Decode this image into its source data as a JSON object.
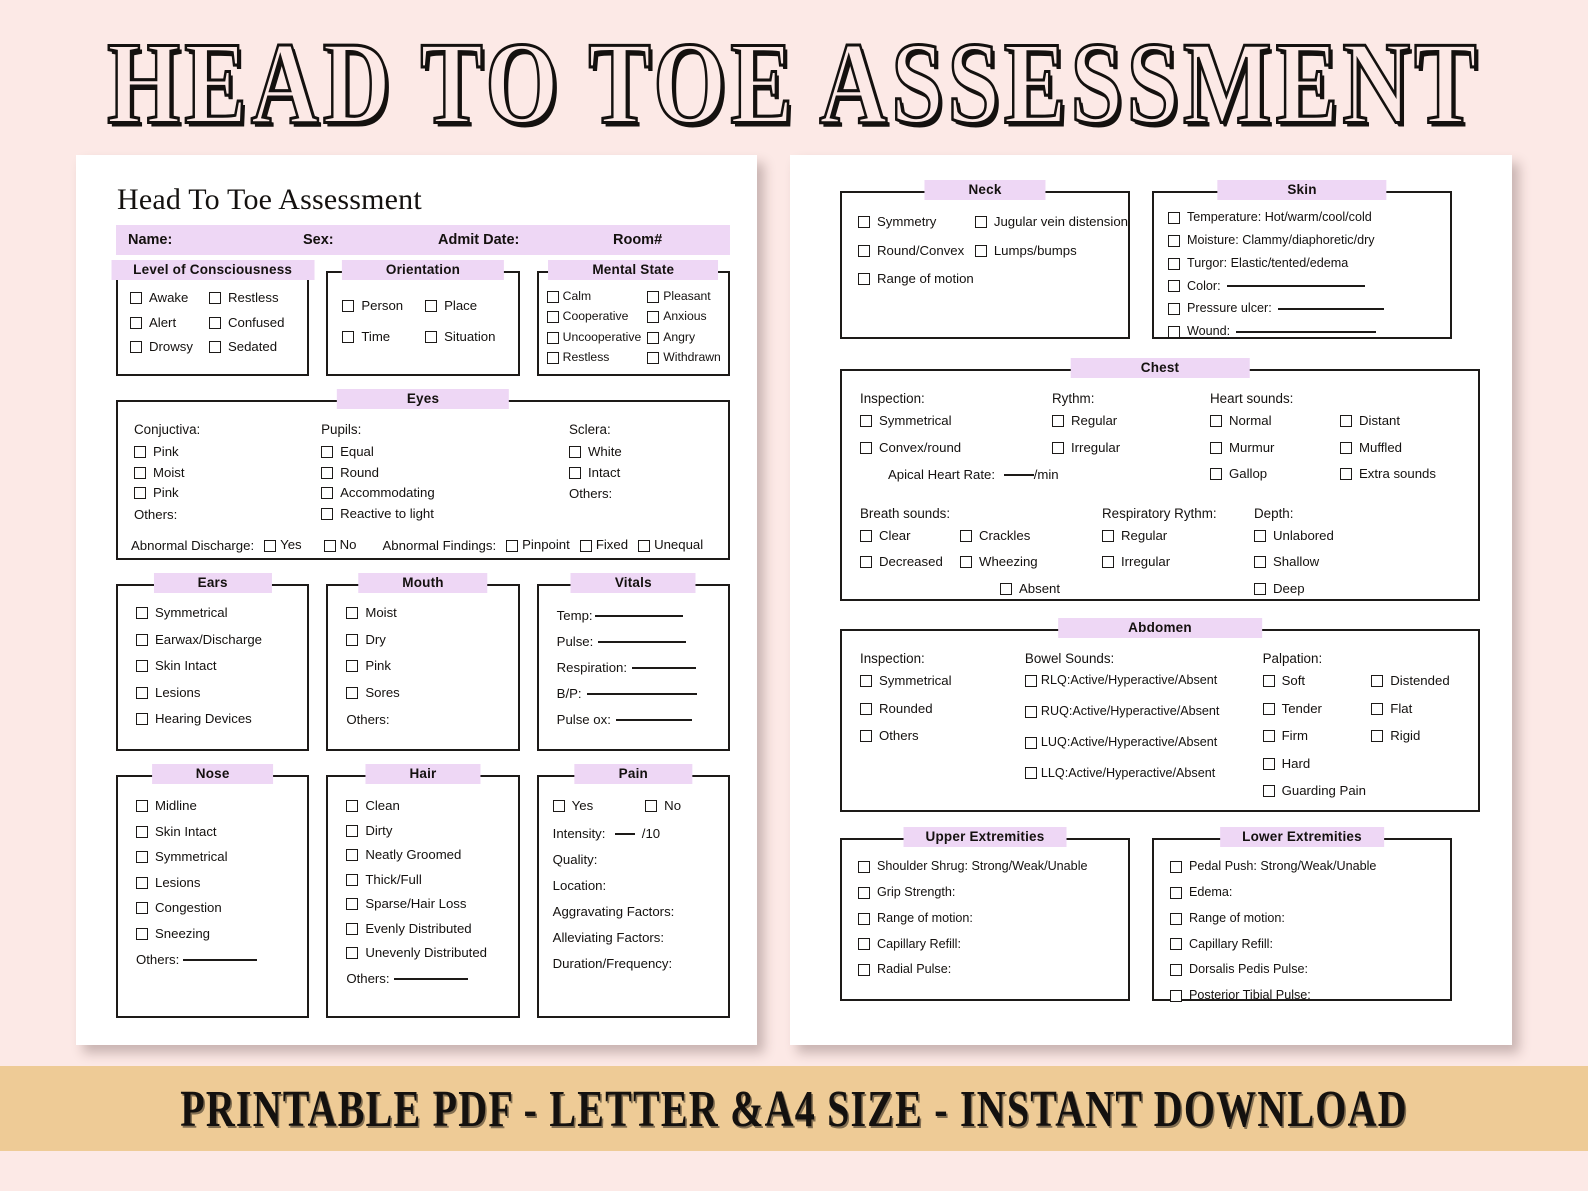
{
  "hero": {
    "title": "HEAD TO TOE ASSESSMENT"
  },
  "footer": {
    "text": "PRINTABLE PDF - LETTER &A4 SIZE - INSTANT DOWNLOAD"
  },
  "colors": {
    "background": "#fce9e6",
    "accent_lavender": "#eed7f5",
    "footer_tan": "#eecb96",
    "ink": "#14110f"
  },
  "left_page": {
    "title": "Head To Toe Assessment",
    "patient_bar": [
      "Name:",
      "Sex:",
      "Admit Date:",
      "Room#"
    ],
    "level_of_consciousness": {
      "legend": "Level of Consciousness",
      "col1": [
        "Awake",
        "Alert",
        "Drowsy"
      ],
      "col2": [
        "Restless",
        "Confused",
        "Sedated"
      ]
    },
    "orientation": {
      "legend": "Orientation",
      "col1": [
        "Person",
        "Time"
      ],
      "col2": [
        "Place",
        "Situation"
      ]
    },
    "mental_state": {
      "legend": "Mental State",
      "col1": [
        "Calm",
        "Cooperative",
        "Uncooperative",
        "Restless"
      ],
      "col2": [
        "Pleasant",
        "Anxious",
        "Angry",
        "Withdrawn"
      ]
    },
    "eyes": {
      "legend": "Eyes",
      "conjuctiva_label": "Conjuctiva:",
      "conjuctiva": [
        "Pink",
        "Moist",
        "Pink"
      ],
      "conjuctiva_others": "Others:",
      "pupils_label": "Pupils:",
      "pupils": [
        "Equal",
        "Round",
        "Accommodating",
        "Reactive to light"
      ],
      "sclera_label": "Sclera:",
      "sclera": [
        "White",
        "Intact"
      ],
      "sclera_others": "Others:",
      "abnormal_discharge_label": "Abnormal Discharge:",
      "abnormal_discharge": [
        "Yes",
        "No"
      ],
      "abnormal_findings_label": "Abnormal Findings:",
      "abnormal_findings": [
        "Pinpoint",
        "Fixed",
        "Unequal"
      ]
    },
    "ears": {
      "legend": "Ears",
      "items": [
        "Symmetrical",
        "Earwax/Discharge",
        "Skin Intact",
        "Lesions",
        "Hearing Devices"
      ]
    },
    "mouth": {
      "legend": "Mouth",
      "items": [
        "Moist",
        "Dry",
        "Pink",
        "Sores"
      ],
      "others": "Others:"
    },
    "vitals": {
      "legend": "Vitals",
      "fields": [
        "Temp:",
        "Pulse:",
        "Respiration:",
        "B/P:",
        "Pulse ox:"
      ]
    },
    "nose": {
      "legend": "Nose",
      "items": [
        "Midline",
        "Skin Intact",
        "Symmetrical",
        "Lesions",
        "Congestion",
        "Sneezing"
      ],
      "others": "Others:"
    },
    "hair": {
      "legend": "Hair",
      "items": [
        "Clean",
        "Dirty",
        "Neatly Groomed",
        "Thick/Full",
        "Sparse/Hair Loss",
        "Evenly Distributed",
        "Unevenly Distributed"
      ],
      "others": "Others:"
    },
    "pain": {
      "legend": "Pain",
      "yes": "Yes",
      "no": "No",
      "intensity": "Intensity:",
      "intensity_suffix": "/10",
      "fields": [
        "Quality:",
        "Location:",
        "Aggravating Factors:",
        "Alleviating Factors:",
        "Duration/Frequency:"
      ]
    }
  },
  "right_page": {
    "neck": {
      "legend": "Neck",
      "col1": [
        "Symmetry",
        "Round/Convex",
        "Range of motion"
      ],
      "col2": [
        "Jugular vein distension",
        "Lumps/bumps"
      ]
    },
    "skin": {
      "legend": "Skin",
      "items": [
        "Temperature: Hot/warm/cool/cold",
        "Moisture: Clammy/diaphoretic/dry",
        "Turgor: Elastic/tented/edema",
        "Color:",
        "Pressure ulcer:",
        "Wound:"
      ]
    },
    "chest": {
      "legend": "Chest",
      "inspection_label": "Inspection:",
      "inspection": [
        "Symmetrical",
        "Convex/round"
      ],
      "apical_label": "Apical Heart Rate:",
      "apical_suffix": "/min",
      "rythm_label": "Rythm:",
      "rythm": [
        "Regular",
        "Irregular"
      ],
      "heart_sounds_label": "Heart sounds:",
      "heart_sounds_col1": [
        "Normal",
        "Murmur",
        "Gallop"
      ],
      "heart_sounds_col2": [
        "Distant",
        "Muffled",
        "Extra sounds"
      ],
      "breath_label": "Breath sounds:",
      "breath_col1": [
        "Clear",
        "Decreased"
      ],
      "breath_col2": [
        "Crackles",
        "Wheezing"
      ],
      "breath_absent": "Absent",
      "resp_rythm_label": "Respiratory Rythm:",
      "resp_rythm": [
        "Regular",
        "Irregular"
      ],
      "depth_label": "Depth:",
      "depth": [
        "Unlabored",
        "Shallow",
        "Deep"
      ]
    },
    "abdomen": {
      "legend": "Abdomen",
      "inspection_label": "Inspection:",
      "inspection": [
        "Symmetrical",
        "Rounded",
        "Others"
      ],
      "bowel_label": "Bowel Sounds:",
      "bowel": [
        "RLQ:Active/Hyperactive/Absent",
        "RUQ:Active/Hyperactive/Absent",
        "LUQ:Active/Hyperactive/Absent",
        "LLQ:Active/Hyperactive/Absent"
      ],
      "palpation_label": "Palpation:",
      "palpation_col1": [
        "Soft",
        "Tender",
        "Firm",
        "Hard",
        "Guarding Pain"
      ],
      "palpation_col2": [
        "Distended",
        "Flat",
        "Rigid"
      ]
    },
    "upper_extremities": {
      "legend": "Upper Extremities",
      "items": [
        "Shoulder Shrug: Strong/Weak/Unable",
        "Grip Strength:",
        "Range of motion:",
        "Capillary Refill:",
        "Radial Pulse:"
      ]
    },
    "lower_extremities": {
      "legend": "Lower Extremities",
      "items": [
        "Pedal Push: Strong/Weak/Unable",
        "Edema:",
        "Range of motion:",
        "Capillary Refill:",
        "Dorsalis Pedis Pulse:",
        "Posterior Tibial Pulse:"
      ]
    }
  }
}
